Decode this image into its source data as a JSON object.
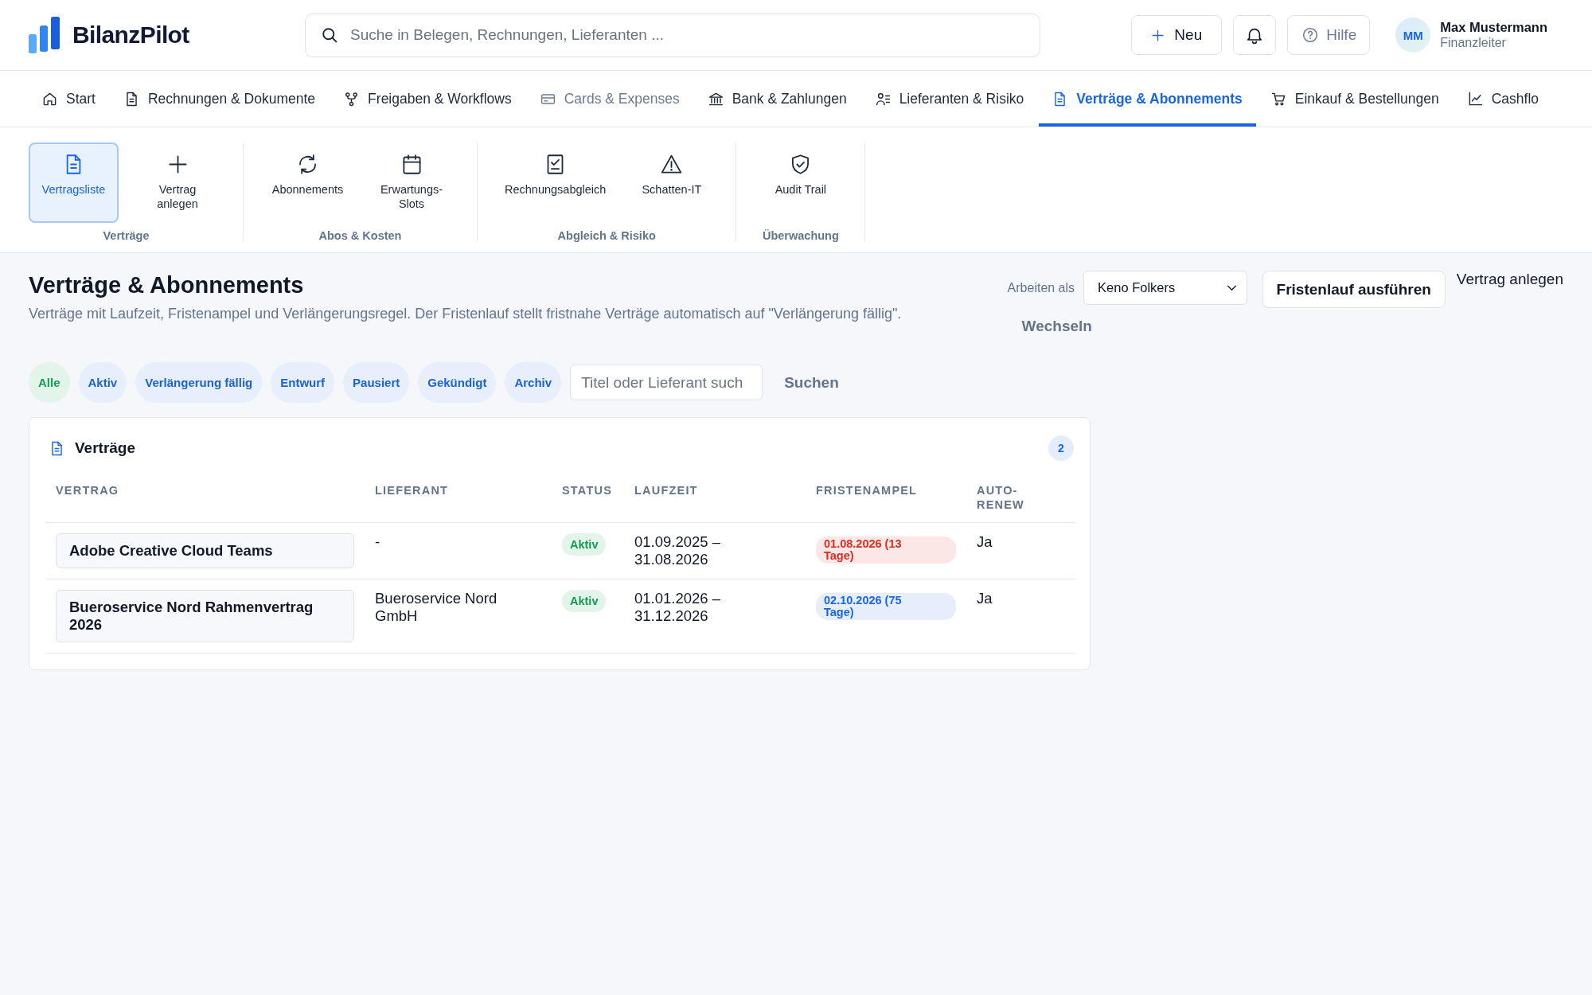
{
  "header": {
    "brand": "BilanzPilot",
    "search": {
      "placeholder": "Suche in Belegen, Rechnungen, Lieferanten ..."
    },
    "new_button": "Neu",
    "help_button": "Hilfe",
    "user": {
      "initials": "MM",
      "name": "Max Mustermann",
      "role": "Finanzleiter"
    }
  },
  "nav": [
    {
      "label": "Start",
      "selected": false,
      "disabled": false
    },
    {
      "label": "Rechnungen & Dokumente",
      "selected": false,
      "disabled": false
    },
    {
      "label": "Freigaben & Workflows",
      "selected": false,
      "disabled": false
    },
    {
      "label": "Cards & Expenses",
      "selected": false,
      "disabled": true
    },
    {
      "label": "Bank & Zahlungen",
      "selected": false,
      "disabled": false
    },
    {
      "label": "Lieferanten & Risiko",
      "selected": false,
      "disabled": false
    },
    {
      "label": "Verträge & Abonnements",
      "selected": true,
      "disabled": false
    },
    {
      "label": "Einkauf & Bestellungen",
      "selected": false,
      "disabled": false
    },
    {
      "label": "Cashflo",
      "selected": false,
      "disabled": false
    }
  ],
  "ribbon": [
    {
      "label": "Verträge",
      "items": [
        {
          "label": "Vertragsliste",
          "selected": true
        },
        {
          "label": "Vertrag anlegen",
          "selected": false
        }
      ]
    },
    {
      "label": "Abos & Kosten",
      "items": [
        {
          "label": "Abonnements",
          "selected": false
        },
        {
          "label": "Erwartungs-Slots",
          "selected": false
        }
      ]
    },
    {
      "label": "Abgleich & Risiko",
      "items": [
        {
          "label": "Rechnungsabgleich",
          "selected": false
        },
        {
          "label": "Schatten-IT",
          "selected": false
        }
      ]
    },
    {
      "label": "Überwachung",
      "items": [
        {
          "label": "Audit Trail",
          "selected": false
        }
      ]
    }
  ],
  "page": {
    "title": "Verträge & Abonnements",
    "subtitle": "Verträge mit Laufzeit, Fristenampel und Verlängerungsregel. Der Fristenlauf stellt fristnahe Verträge automatisch auf \"Verlängerung fällig\".",
    "work_as": {
      "label": "Arbeiten als",
      "value": "Keno Folkers",
      "button": "Wechseln"
    },
    "run_button": "Fristenlauf ausführen",
    "create_link": "Vertrag anlegen"
  },
  "filters": [
    {
      "label": "Alle",
      "selected": true
    },
    {
      "label": "Aktiv",
      "selected": false
    },
    {
      "label": "Verlängerung fällig",
      "selected": false
    },
    {
      "label": "Entwurf",
      "selected": false
    },
    {
      "label": "Pausiert",
      "selected": false
    },
    {
      "label": "Gekündigt",
      "selected": false
    },
    {
      "label": "Archiv",
      "selected": false
    }
  ],
  "filter_search": {
    "placeholder": "Titel oder Lieferant such",
    "button": "Suchen"
  },
  "contracts": {
    "title": "Verträge",
    "count": "2",
    "columns": [
      "VERTRAG",
      "LIEFERANT",
      "STATUS",
      "LAUFZEIT",
      "FRISTENAMPEL",
      "AUTO-RENEW"
    ],
    "rows": [
      {
        "contract": "Adobe Creative Cloud Teams",
        "supplier": "-",
        "status": "Aktiv",
        "term": "01.09.2025 – 31.08.2026",
        "deadline": {
          "text": "01.08.2026 (13 Tage)",
          "color": "#d92d20"
        },
        "auto_renew": "Ja"
      },
      {
        "contract": "Bueroservice Nord Rahmenvertrag 2026",
        "supplier": "Bueroservice Nord GmbH",
        "status": "Aktiv",
        "term": "01.01.2026 – 31.12.2026",
        "deadline": {
          "text": "02.10.2026 (75 Tage)",
          "color": "#1a66e0"
        },
        "auto_renew": "Ja"
      }
    ]
  }
}
